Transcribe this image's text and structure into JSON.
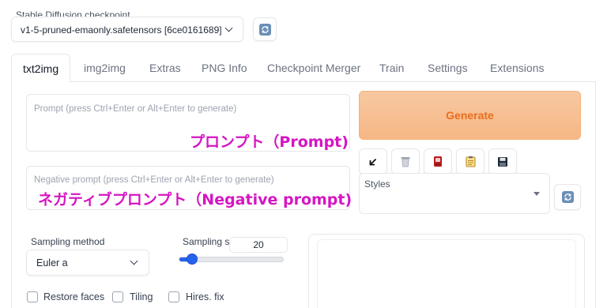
{
  "checkpoint": {
    "label": "Stable Diffusion checkpoint",
    "value": "v1-5-pruned-emaonly.safetensors [6ce0161689]"
  },
  "tabs": [
    {
      "label": "txt2img",
      "active": true
    },
    {
      "label": "img2img",
      "active": false
    },
    {
      "label": "Extras",
      "active": false
    },
    {
      "label": "PNG Info",
      "active": false
    },
    {
      "label": "Checkpoint Merger",
      "active": false
    },
    {
      "label": "Train",
      "active": false
    },
    {
      "label": "Settings",
      "active": false
    },
    {
      "label": "Extensions",
      "active": false
    }
  ],
  "prompt": {
    "placeholder": "Prompt (press Ctrl+Enter or Alt+Enter to generate)",
    "annotation": "プロンプト（Prompt)"
  },
  "negative_prompt": {
    "placeholder": "Negative prompt (press Ctrl+Enter or Alt+Enter to generate)",
    "annotation": "ネガティブプロンプト（Negative prompt)"
  },
  "generate": {
    "label": "Generate"
  },
  "tools": [
    {
      "icon": "arrow-down-left-icon"
    },
    {
      "icon": "trash-icon"
    },
    {
      "icon": "red-card-icon"
    },
    {
      "icon": "clipboard-icon"
    },
    {
      "icon": "floppy-disk-icon"
    }
  ],
  "styles": {
    "label": "Styles"
  },
  "sampling_method": {
    "label": "Sampling method",
    "value": "Euler a"
  },
  "sampling_steps": {
    "label": "Sampling st",
    "value": "20",
    "fraction": 0.13
  },
  "checkboxes": [
    {
      "label": "Restore faces",
      "checked": false
    },
    {
      "label": "Tiling",
      "checked": false
    },
    {
      "label": "Hires. fix",
      "checked": false
    }
  ],
  "colors": {
    "generate_bg": "#f6b785",
    "generate_text": "#ea6d1d",
    "annotation": "#d515c3",
    "accent": "#2563eb"
  }
}
